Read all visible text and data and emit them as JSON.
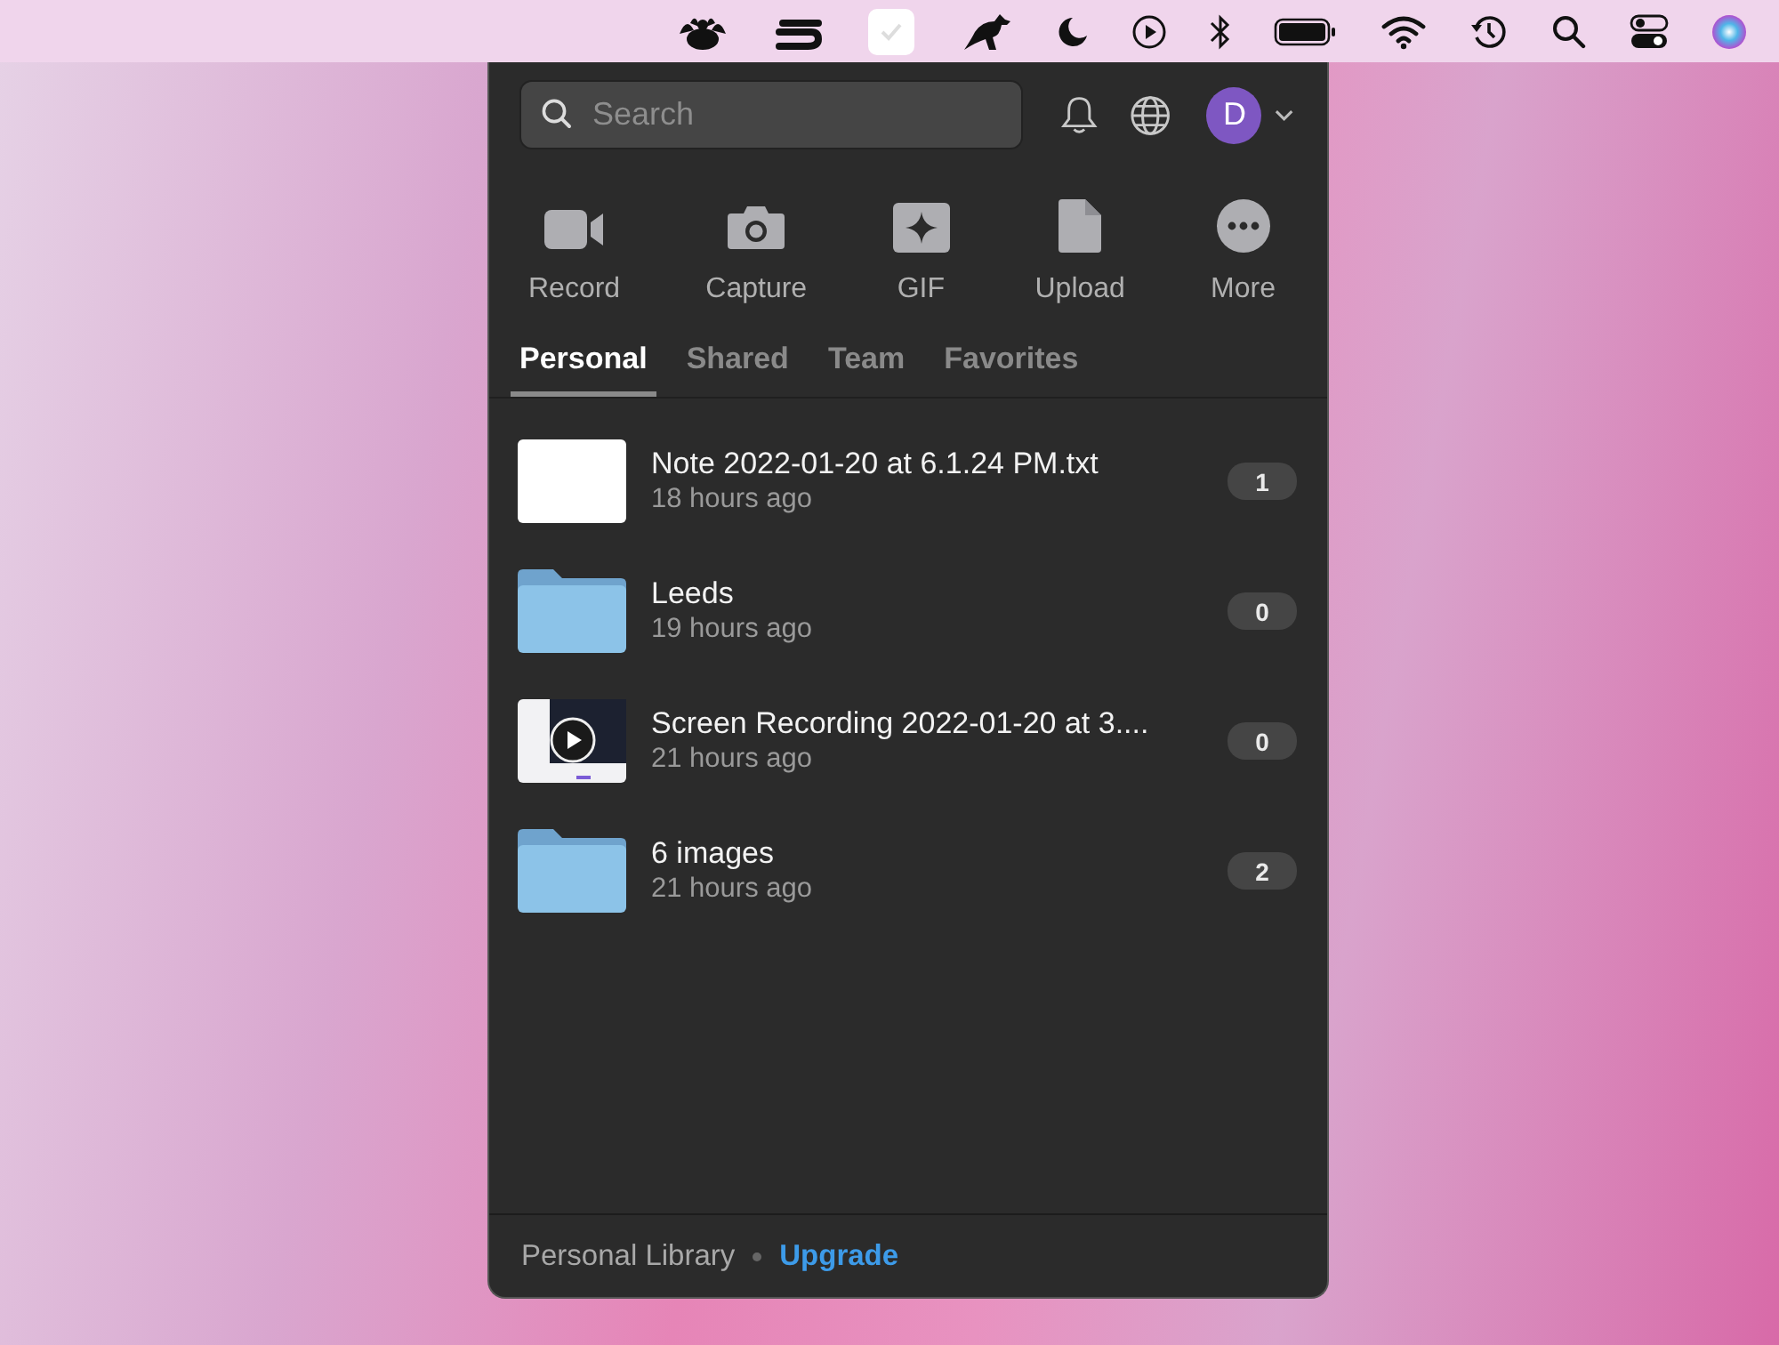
{
  "search": {
    "placeholder": "Search"
  },
  "avatar": {
    "initial": "D"
  },
  "actions": [
    {
      "kind": "record",
      "label": "Record"
    },
    {
      "kind": "capture",
      "label": "Capture"
    },
    {
      "kind": "gif",
      "label": "GIF"
    },
    {
      "kind": "upload",
      "label": "Upload"
    },
    {
      "kind": "more",
      "label": "More"
    }
  ],
  "tabs": [
    {
      "label": "Personal",
      "selected": true
    },
    {
      "label": "Shared",
      "selected": false
    },
    {
      "label": "Team",
      "selected": false
    },
    {
      "label": "Favorites",
      "selected": false
    }
  ],
  "items": [
    {
      "kind": "note",
      "title": "Note 2022-01-20 at 6.1.24 PM.txt",
      "time": "18 hours ago",
      "count": "1"
    },
    {
      "kind": "folder",
      "title": "Leeds",
      "time": "19 hours ago",
      "count": "0"
    },
    {
      "kind": "video",
      "title": "Screen Recording 2022-01-20 at 3....",
      "time": "21 hours ago",
      "count": "0"
    },
    {
      "kind": "folder",
      "title": "6 images",
      "time": "21 hours ago",
      "count": "2"
    }
  ],
  "footer": {
    "library": "Personal Library",
    "upgrade": "Upgrade"
  }
}
